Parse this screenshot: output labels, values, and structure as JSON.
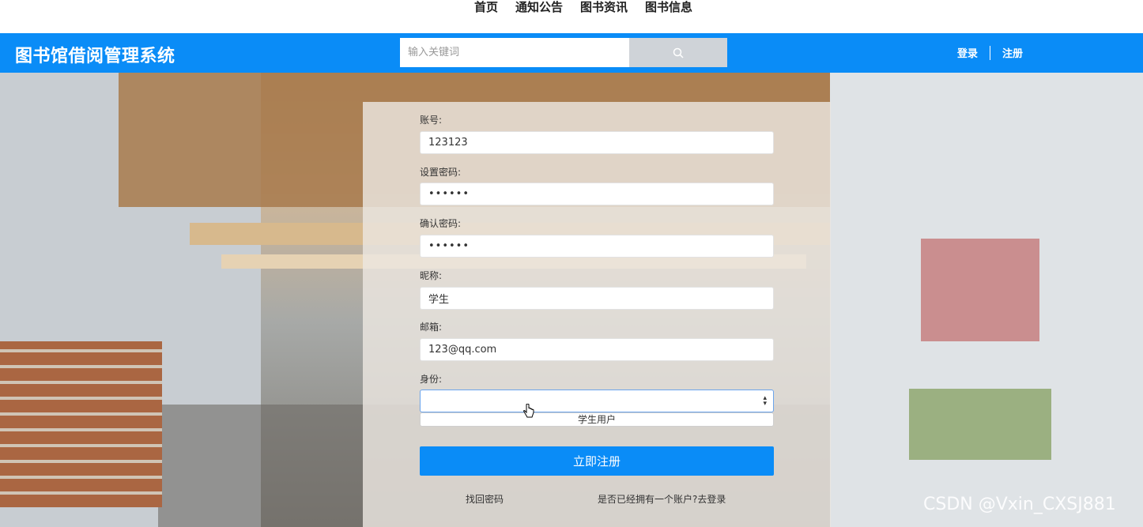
{
  "topnav": {
    "items": [
      "首页",
      "通知公告",
      "图书资讯",
      "图书信息"
    ]
  },
  "header": {
    "logo": "图书馆借阅管理系统",
    "search_placeholder": "输入关键词",
    "login": "登录",
    "register": "注册"
  },
  "form": {
    "account_label": "账号:",
    "account_value": "123123",
    "password_label": "设置密码:",
    "password_value": "••••••",
    "confirm_label": "确认密码:",
    "confirm_value": "••••••",
    "nickname_label": "昵称:",
    "nickname_value": "学生",
    "email_label": "邮箱:",
    "email_value": "123@qq.com",
    "identity_label": "身份:",
    "identity_option": "学生用户",
    "submit": "立即注册",
    "forgot": "找回密码",
    "has_account": "是否已经拥有一个账户?去登录"
  },
  "watermark": "CSDN @Vxin_CXSJ881",
  "colors": {
    "primary": "#0a8cf7",
    "search_button": "#cfd3d8"
  }
}
